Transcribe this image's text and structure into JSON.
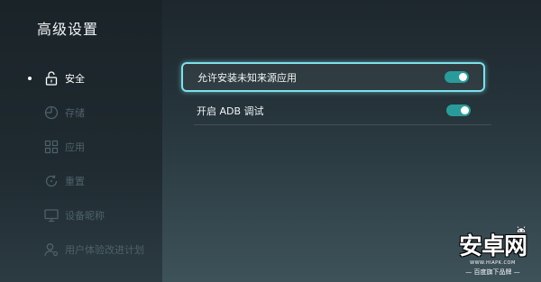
{
  "title": "高级设置",
  "sidebar": {
    "items": [
      {
        "label": "安全",
        "icon": "lock-open-icon",
        "active": true
      },
      {
        "label": "存储",
        "icon": "storage-pie-icon",
        "active": false
      },
      {
        "label": "应用",
        "icon": "apps-grid-icon",
        "active": false
      },
      {
        "label": "重置",
        "icon": "reset-icon",
        "active": false
      },
      {
        "label": "设备昵称",
        "icon": "monitor-icon",
        "active": false
      },
      {
        "label": "用户体验改进计划",
        "icon": "user-settings-icon",
        "active": false
      }
    ]
  },
  "settings": [
    {
      "label": "允许安装未知来源应用",
      "enabled": true,
      "focused": true
    },
    {
      "label": "开启 ADB 调试",
      "enabled": true,
      "focused": false
    }
  ],
  "colors": {
    "accent": "#2a9b9b",
    "focus_border": "#7fe0ea",
    "inactive_text": "#4f6169"
  },
  "watermark": {
    "logo": "安卓网",
    "url": "WWW.HIAPK.COM",
    "slogan": "— 百度旗下品牌 —"
  }
}
